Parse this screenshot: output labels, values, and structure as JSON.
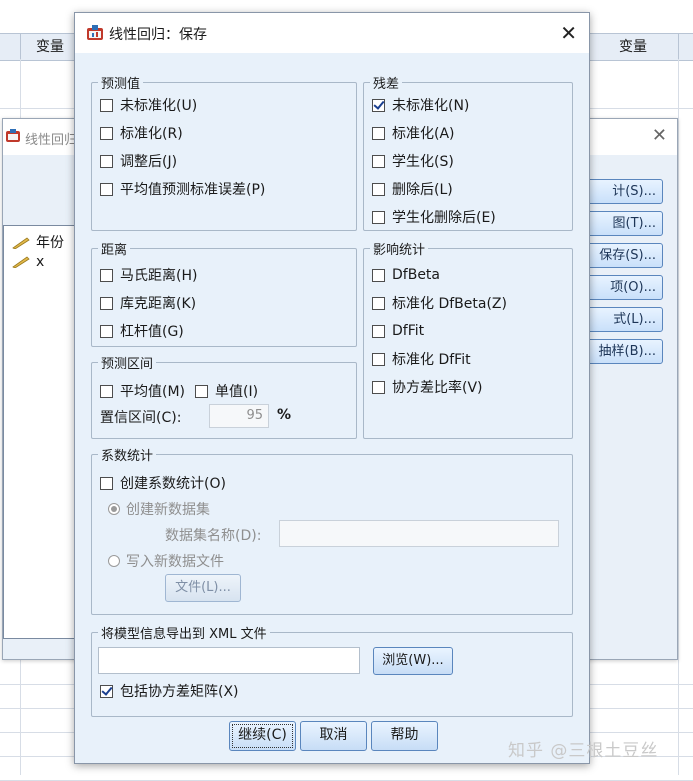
{
  "background_sheet": {
    "col_header_left": "变量",
    "col_header_right": "变量"
  },
  "parent_dialog": {
    "title": "线性回归",
    "variables": [
      "年份",
      "x"
    ],
    "buttons": [
      "统计(S)...",
      "图(T)...",
      "保存(S)...",
      "选项(O)...",
      "样式(L)...",
      "自助抽样(B)..."
    ],
    "buttons_visible": [
      "计(S)...",
      "图(T)...",
      "保存(S)...",
      "项(O)...",
      "式(L)...",
      "抽样(B)..."
    ]
  },
  "dialog": {
    "title": "线性回归：保存",
    "close_glyph": "✕",
    "predicted": {
      "legend": "预测值",
      "items": [
        {
          "label": "未标准化(U)",
          "checked": false
        },
        {
          "label": "标准化(R)",
          "checked": false
        },
        {
          "label": "调整后(J)",
          "checked": false
        },
        {
          "label": "平均值预测标准误差(P)",
          "checked": false
        }
      ]
    },
    "residuals": {
      "legend": "残差",
      "items": [
        {
          "label": "未标准化(N)",
          "checked": true
        },
        {
          "label": "标准化(A)",
          "checked": false
        },
        {
          "label": "学生化(S)",
          "checked": false
        },
        {
          "label": "删除后(L)",
          "checked": false
        },
        {
          "label": "学生化删除后(E)",
          "checked": false
        }
      ]
    },
    "distances": {
      "legend": "距离",
      "items": [
        {
          "label": "马氏距离(H)",
          "checked": false
        },
        {
          "label": "库克距离(K)",
          "checked": false
        },
        {
          "label": "杠杆值(G)",
          "checked": false
        }
      ]
    },
    "influence": {
      "legend": "影响统计",
      "items": [
        {
          "label": "DfBeta",
          "checked": false
        },
        {
          "label": "标准化 DfBeta(Z)",
          "checked": false
        },
        {
          "label": "DfFit",
          "checked": false
        },
        {
          "label": "标准化 DfFit",
          "checked": false
        },
        {
          "label": "协方差比率(V)",
          "checked": false
        }
      ]
    },
    "pred_interval": {
      "legend": "预测区间",
      "mean_label": "平均值(M)",
      "single_label": "单值(I)",
      "ci_label": "置信区间(C):",
      "ci_value": "95",
      "ci_unit": "%"
    },
    "coef_stats": {
      "legend": "系数统计",
      "create_label": "创建系数统计(O)",
      "new_dataset_label": "创建新数据集",
      "dataset_name_label": "数据集名称(D):",
      "dataset_name_value": "",
      "write_file_label": "写入新数据文件",
      "file_button": "文件(L)..."
    },
    "xml_export": {
      "legend": "将模型信息导出到 XML 文件",
      "path_value": "",
      "browse_button": "浏览(W)...",
      "include_cov_label": "包括协方差矩阵(X)",
      "include_cov_checked": true
    },
    "buttons": {
      "continue": "继续(C)",
      "cancel": "取消",
      "help": "帮助"
    }
  },
  "watermark": "知乎 @三根土豆丝"
}
